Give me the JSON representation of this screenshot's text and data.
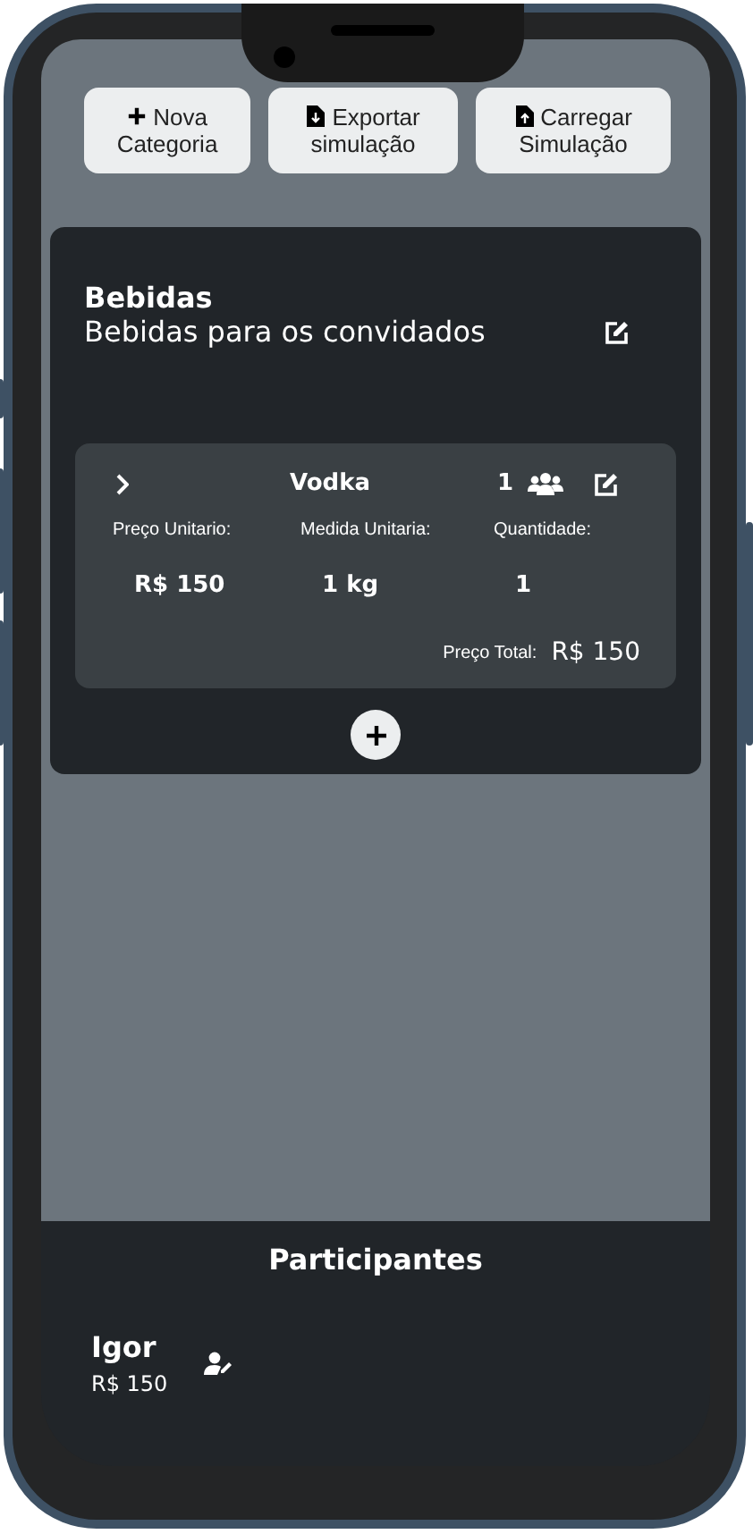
{
  "toolbar": [
    {
      "kind": "plus",
      "label": "Nova Categoria"
    },
    {
      "kind": "export",
      "label": "Exportar simulação"
    },
    {
      "kind": "import",
      "label": "Carregar Simulação"
    }
  ],
  "categories": [
    {
      "title": "Bebidas",
      "description": "Bebidas para os convidados",
      "items": [
        {
          "name": "Vodka",
          "participants": "1",
          "fields": [
            {
              "label": "Preço Unitario:",
              "value": "R$ 150"
            },
            {
              "label": "Medida Unitaria:",
              "value": "1 kg"
            },
            {
              "label": "Quantidade:",
              "value": "1"
            }
          ],
          "total_label": "Preço Total:",
          "total": "R$ 150"
        }
      ]
    }
  ],
  "participants": {
    "title": "Participantes",
    "people": [
      {
        "name": "Igor",
        "amount": "R$ 150"
      }
    ]
  }
}
